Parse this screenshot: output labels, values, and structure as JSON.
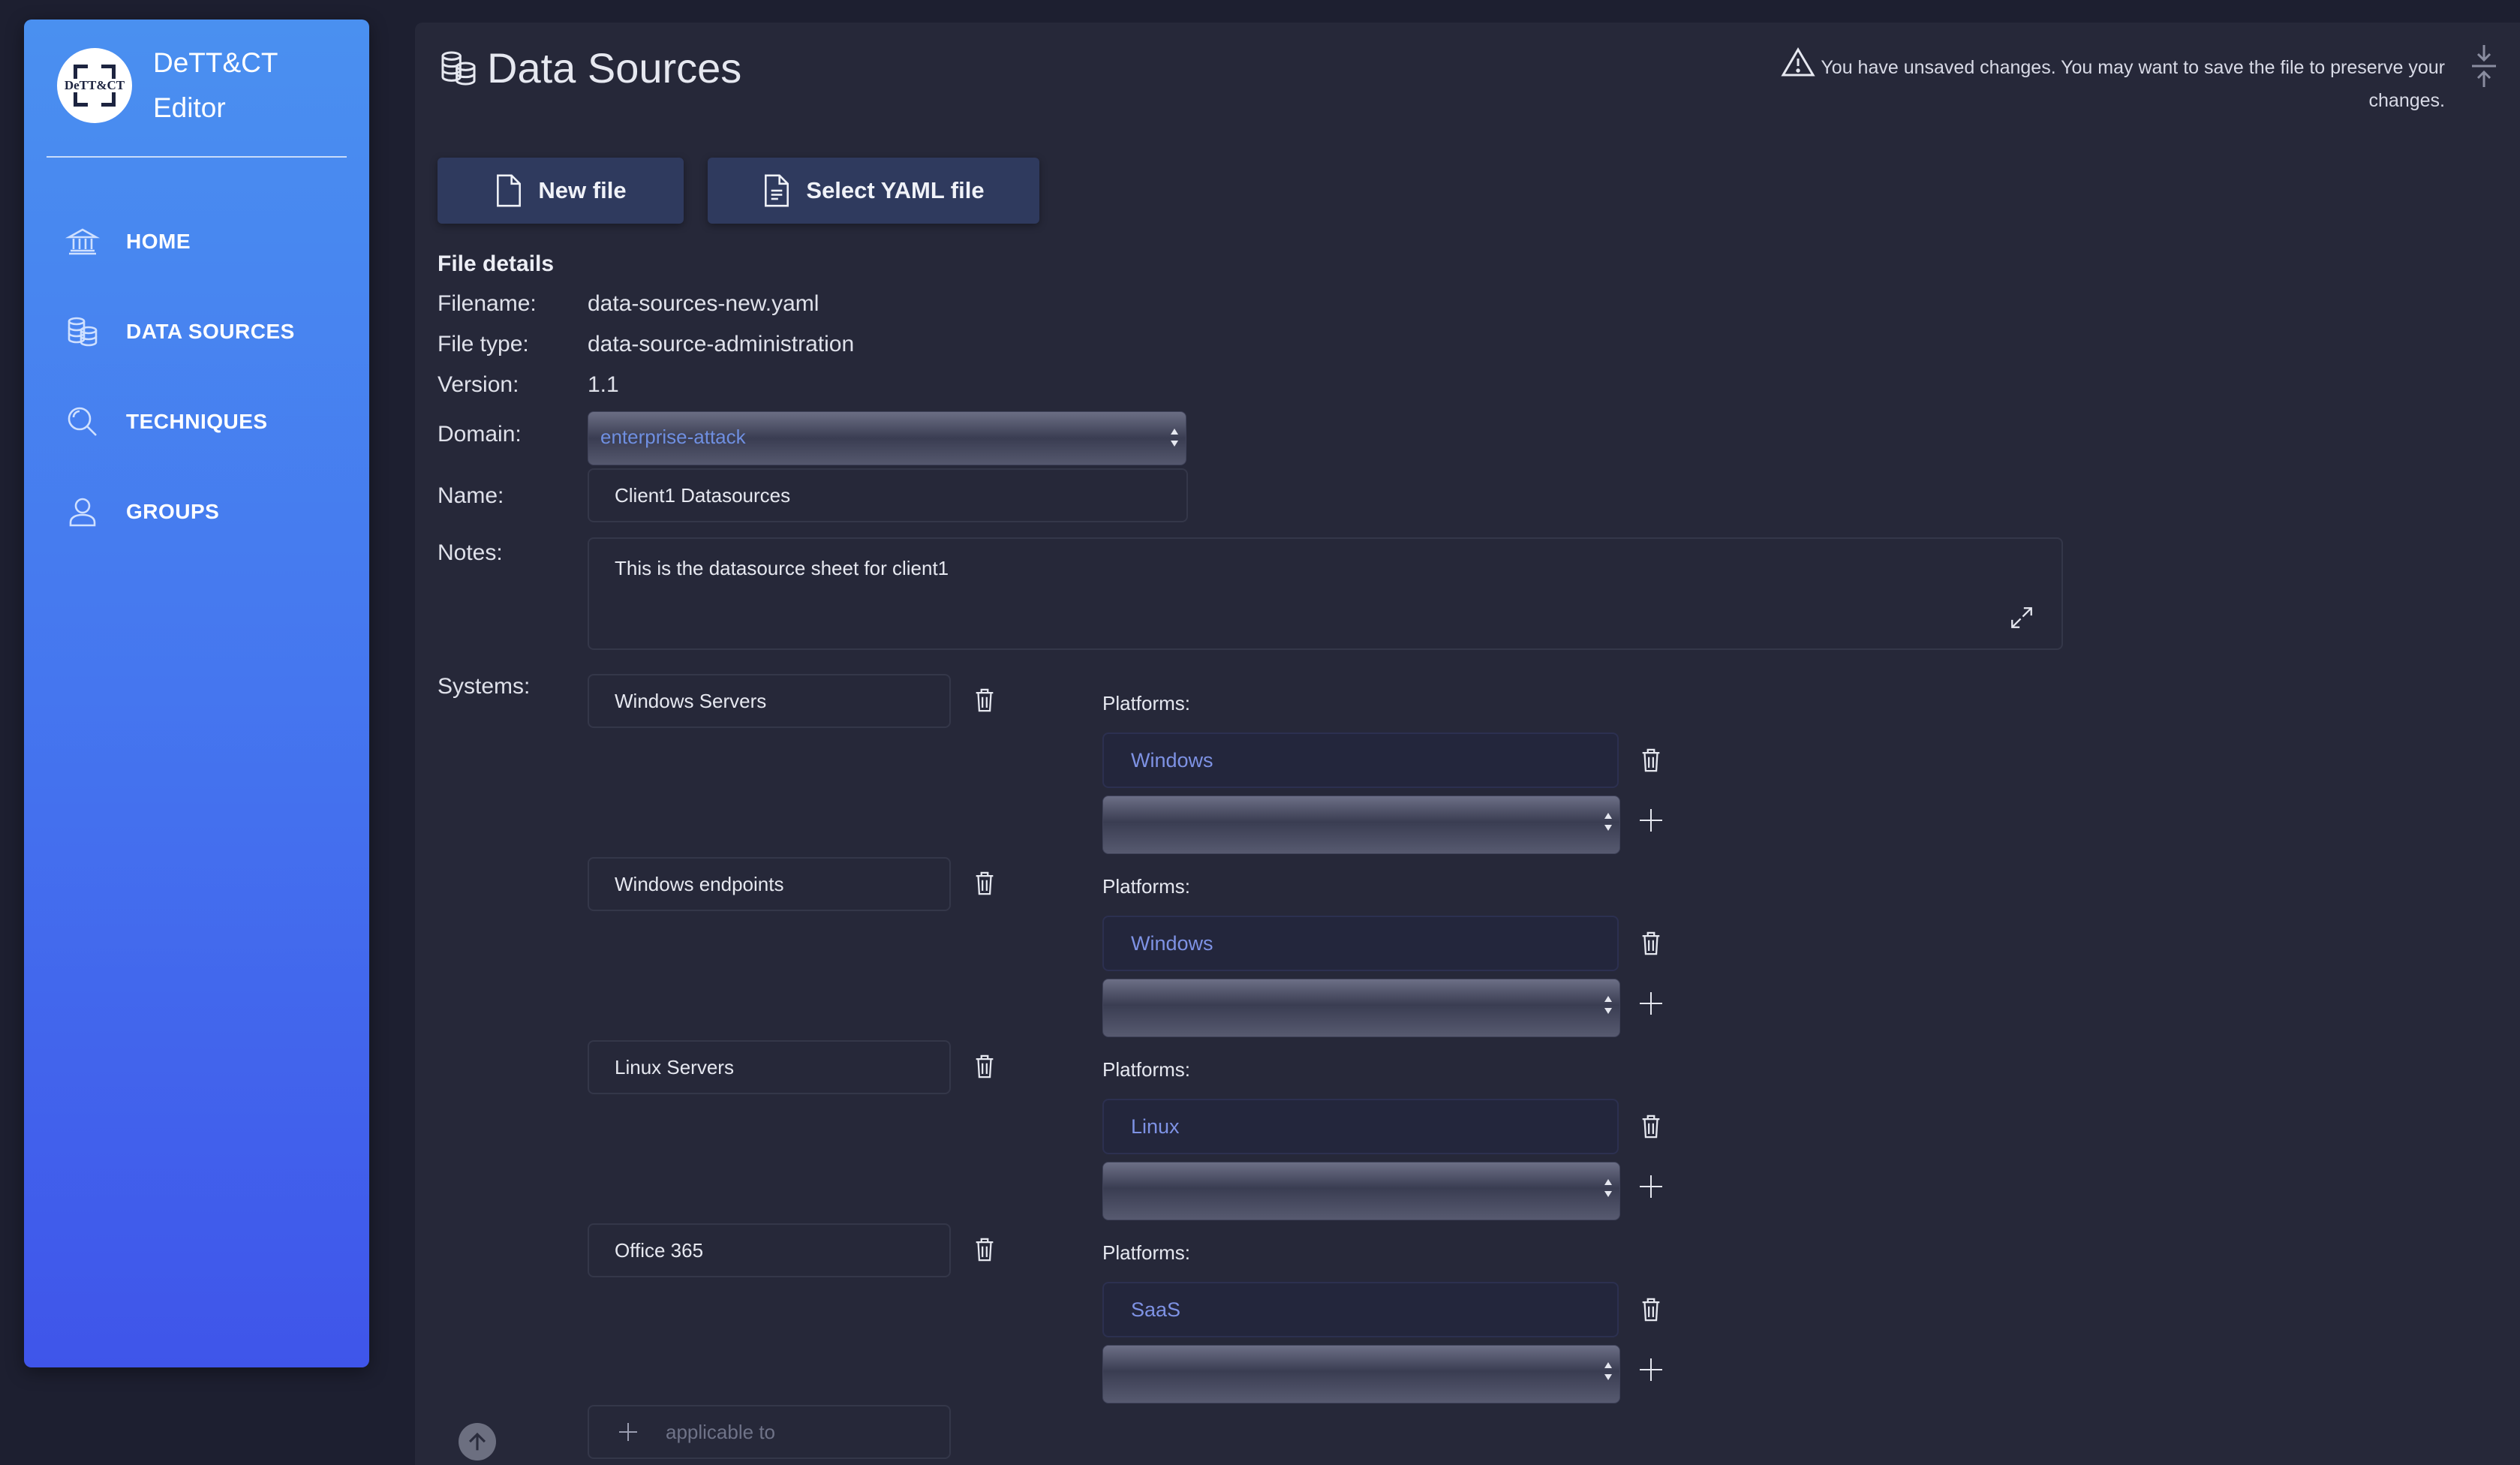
{
  "sidebar": {
    "brand_logo_text": "DeTT&CT",
    "brand_line1": "DeTT&CT",
    "brand_line2": "Editor",
    "items": [
      {
        "label": "HOME",
        "icon": "bank-icon"
      },
      {
        "label": "DATA SOURCES",
        "icon": "database-icon"
      },
      {
        "label": "TECHNIQUES",
        "icon": "search-icon"
      },
      {
        "label": "GROUPS",
        "icon": "user-icon"
      }
    ]
  },
  "header": {
    "title": "Data Sources",
    "warning_line1": "You have unsaved changes. You may want to save the file to preserve your",
    "warning_line2": "changes."
  },
  "toolbar": {
    "new_file_label": "New file",
    "select_yaml_label": "Select YAML file"
  },
  "file_details": {
    "section_title": "File details",
    "filename_label": "Filename:",
    "filename": "data-sources-new.yaml",
    "filetype_label": "File type:",
    "filetype": "data-source-administration",
    "version_label": "Version:",
    "version": "1.1",
    "domain_label": "Domain:",
    "domain": "enterprise-attack",
    "name_label": "Name:",
    "name": "Client1 Datasources",
    "notes_label": "Notes:",
    "notes": "This is the datasource sheet for client1"
  },
  "systems": {
    "label": "Systems:",
    "platforms_label": "Platforms:",
    "add_placeholder": "applicable to",
    "items": [
      {
        "name": "Windows Servers",
        "platform": "Windows"
      },
      {
        "name": "Windows endpoints",
        "platform": "Windows"
      },
      {
        "name": "Linux Servers",
        "platform": "Linux"
      },
      {
        "name": "Office 365",
        "platform": "SaaS"
      }
    ]
  },
  "colors": {
    "sidebar_top": "#4a90f0",
    "sidebar_bottom": "#3f55ea",
    "background": "#1d1f30",
    "panel": "#262839",
    "button": "#2f3a5e",
    "platform_text": "#7e92e4"
  }
}
